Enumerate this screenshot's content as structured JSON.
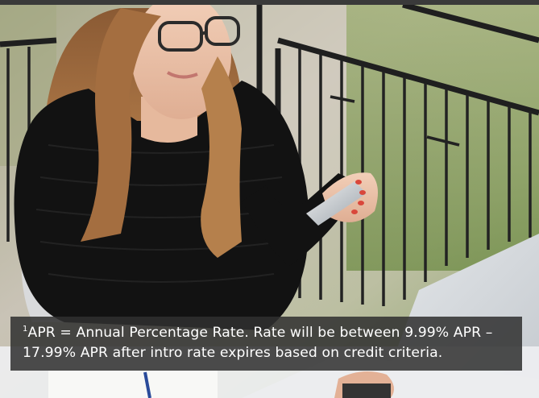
{
  "image": {
    "subject": "photo-woman-holding-credit-card"
  },
  "disclaimer": {
    "footnote_marker": "1",
    "line1": "APR = Annual Percentage Rate. Rate will be between 9.99% APR –",
    "line2": "17.99% APR after intro rate expires based on credit criteria."
  },
  "colors": {
    "overlay": "#303030",
    "text": "#ffffff"
  }
}
